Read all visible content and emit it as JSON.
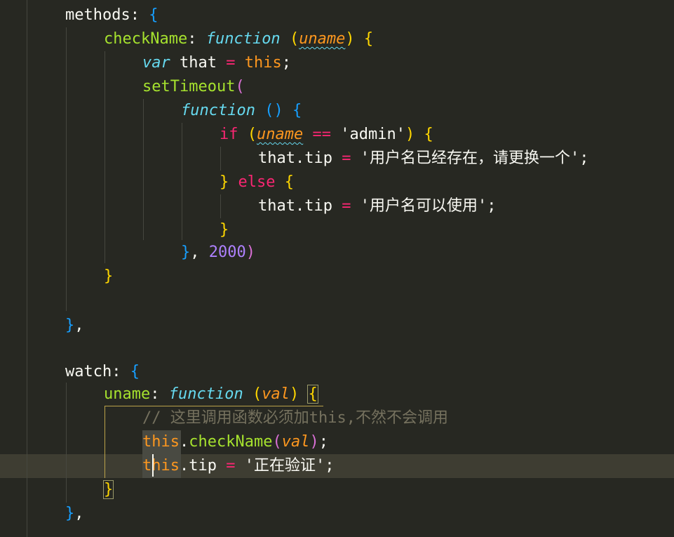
{
  "editor": {
    "theme_colors": {
      "background": "#272822",
      "active_line": "#3e3d32",
      "keyword": "#f92672",
      "storage_type": "#66d9ef",
      "function_name": "#a6e22e",
      "this_and_params": "#fd971f",
      "string": "#e6db74",
      "number": "#ae81ff",
      "comment": "#75715e",
      "bracket_level1": "#ffd700",
      "bracket_level2": "#da70d6",
      "bracket_level3": "#179fff"
    },
    "cursor": {
      "line_index": 19,
      "after_text": "th"
    },
    "active_line_index": 19,
    "lines": [
      {
        "t": [
          [
            "methods",
            "pl"
          ],
          [
            ": ",
            "pl"
          ],
          [
            "{",
            "br-b"
          ]
        ]
      },
      {
        "t": [
          [
            "checkName",
            "fn"
          ],
          [
            ": ",
            "pl"
          ],
          [
            "function",
            "ital"
          ],
          [
            " ",
            "pl"
          ],
          [
            "(",
            "br-y"
          ],
          [
            "uname",
            "param squiggle"
          ],
          [
            ")",
            "br-y"
          ],
          [
            " ",
            "pl"
          ],
          [
            "{",
            "br-y"
          ]
        ]
      },
      {
        "t": [
          [
            "var",
            "ital"
          ],
          [
            " that ",
            "pl"
          ],
          [
            "=",
            "kw"
          ],
          [
            " ",
            "pl"
          ],
          [
            "this",
            "this"
          ],
          [
            ";",
            "pl"
          ]
        ]
      },
      {
        "t": [
          [
            "setTimeout",
            "fn"
          ],
          [
            "(",
            "br-p"
          ]
        ]
      },
      {
        "t": [
          [
            "function",
            "ital"
          ],
          [
            " ",
            "pl"
          ],
          [
            "()",
            "br-b"
          ],
          [
            " ",
            "pl"
          ],
          [
            "{",
            "br-b"
          ]
        ]
      },
      {
        "t": [
          [
            "if",
            "kw"
          ],
          [
            " ",
            "pl"
          ],
          [
            "(",
            "br-y"
          ],
          [
            "uname",
            "param squiggle"
          ],
          [
            " ",
            "pl"
          ],
          [
            "==",
            "kw"
          ],
          [
            " ",
            "pl"
          ],
          [
            "'admin'",
            "pl"
          ],
          [
            ")",
            "br-y"
          ],
          [
            " ",
            "pl"
          ],
          [
            "{",
            "br-y"
          ]
        ]
      },
      {
        "t": [
          [
            "that.tip ",
            "pl"
          ],
          [
            "=",
            "kw"
          ],
          [
            " ",
            "pl"
          ],
          [
            "'用户名已经存在，请更换一个'",
            "pl"
          ],
          [
            ";",
            "pl"
          ]
        ]
      },
      {
        "t": [
          [
            "}",
            "br-y"
          ],
          [
            " ",
            "pl"
          ],
          [
            "else",
            "kw"
          ],
          [
            " ",
            "pl"
          ],
          [
            "{",
            "br-y"
          ]
        ]
      },
      {
        "t": [
          [
            "that.tip ",
            "pl"
          ],
          [
            "=",
            "kw"
          ],
          [
            " ",
            "pl"
          ],
          [
            "'用户名可以使用'",
            "pl"
          ],
          [
            ";",
            "pl"
          ]
        ]
      },
      {
        "t": [
          [
            "}",
            "br-y"
          ]
        ]
      },
      {
        "t": [
          [
            "}",
            "br-b"
          ],
          [
            ", ",
            "pl"
          ],
          [
            "2000",
            "num"
          ],
          [
            ")",
            "br-p"
          ]
        ]
      },
      {
        "t": [
          [
            "}",
            "br-y"
          ]
        ]
      },
      {
        "t": []
      },
      {
        "t": [
          [
            "}",
            "br-b"
          ],
          [
            ",",
            "pl"
          ]
        ]
      },
      {
        "t": []
      },
      {
        "t": [
          [
            "watch",
            "pl"
          ],
          [
            ": ",
            "pl"
          ],
          [
            "{",
            "br-b"
          ]
        ]
      },
      {
        "t": [
          [
            "uname",
            "fn"
          ],
          [
            ": ",
            "pl"
          ],
          [
            "function",
            "ital"
          ],
          [
            " ",
            "pl"
          ],
          [
            "(",
            "br-y"
          ],
          [
            "val",
            "param"
          ],
          [
            ")",
            "br-y"
          ],
          [
            " ",
            "pl"
          ],
          [
            "{",
            "br-y bracket-box"
          ]
        ]
      },
      {
        "t": [
          [
            "// 这里调用函数必须加this,不然不会调用",
            "cmt"
          ]
        ]
      },
      {
        "t": [
          [
            "this",
            "this"
          ],
          [
            ".",
            "pl"
          ],
          [
            "checkName",
            "fn"
          ],
          [
            "(",
            "br-p"
          ],
          [
            "val",
            "param"
          ],
          [
            ")",
            "br-p"
          ],
          [
            ";",
            "pl"
          ]
        ]
      },
      {
        "t": [
          [
            "this",
            "this"
          ],
          [
            ".tip ",
            "pl"
          ],
          [
            "=",
            "kw"
          ],
          [
            " ",
            "pl"
          ],
          [
            "'正在验证'",
            "pl"
          ],
          [
            ";",
            "pl"
          ]
        ]
      },
      {
        "t": [
          [
            "}",
            "br-y bracket-box"
          ]
        ]
      },
      {
        "t": [
          [
            "}",
            "br-b"
          ],
          [
            ",",
            "pl"
          ]
        ]
      }
    ]
  }
}
